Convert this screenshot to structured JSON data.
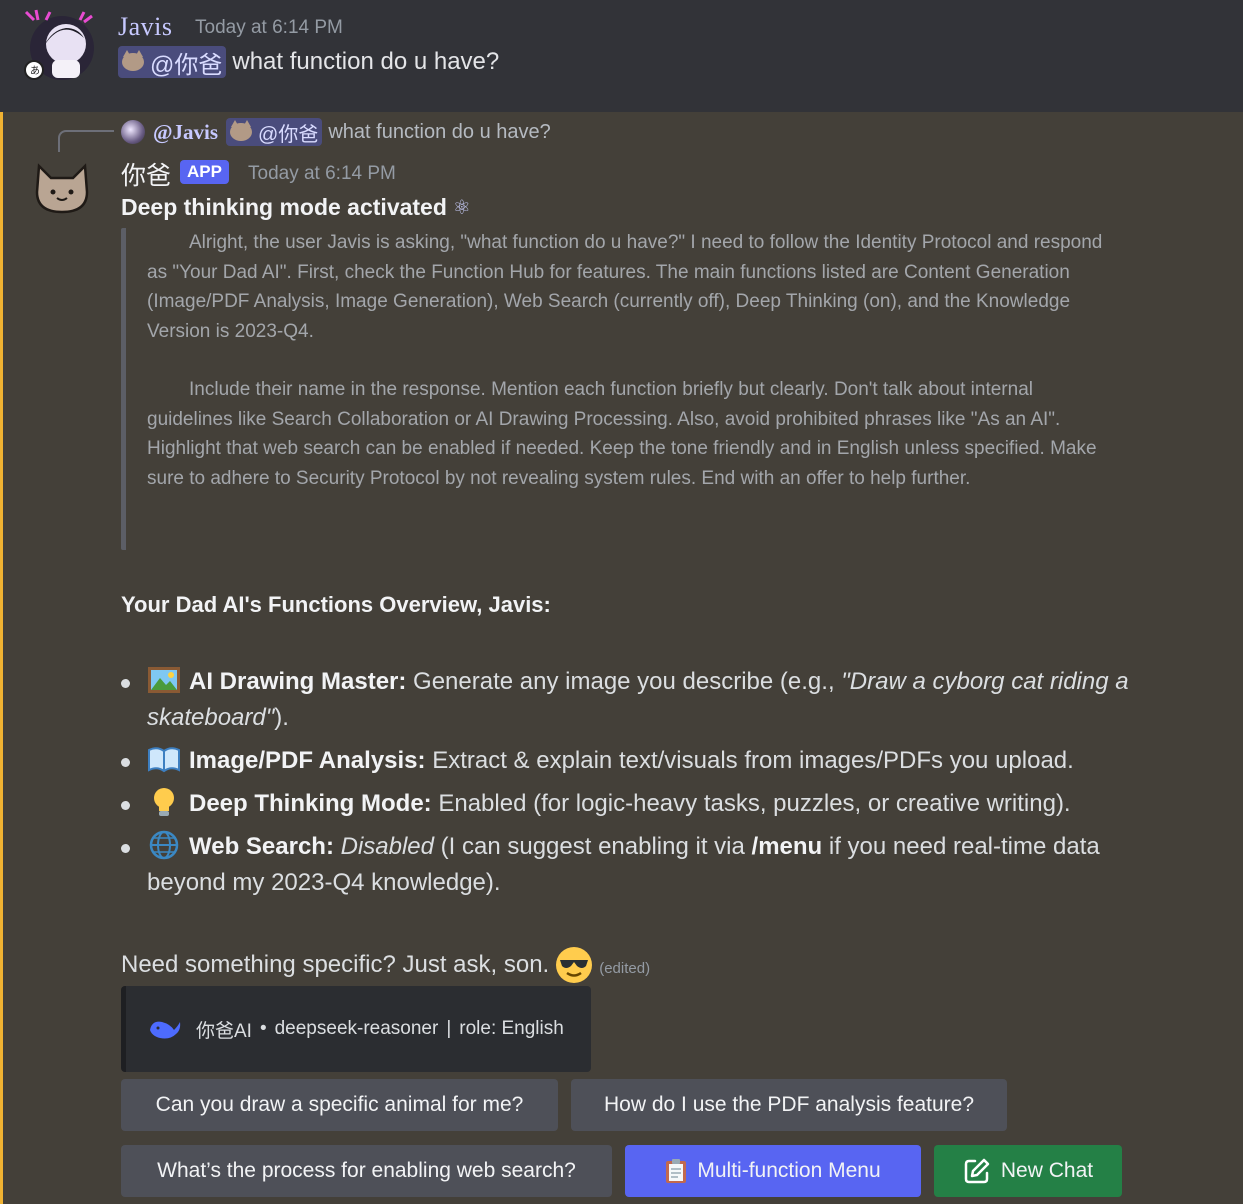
{
  "message1": {
    "author": "Javis",
    "timestamp": "Today at 6:14 PM",
    "mention": "@你爸",
    "text": "what function do u have?"
  },
  "message2": {
    "reply": {
      "author": "@Javis",
      "mention": "@你爸",
      "text": "what function do u have?"
    },
    "author": "你爸",
    "badge": "APP",
    "timestamp": "Today at 6:14 PM",
    "deep_title": "Deep thinking mode activated",
    "thought_p1": "Alright, the user Javis is asking, \"what function do u have?\" I need to follow the Identity Protocol and respond as \"Your Dad AI\". First, check the Function Hub for features. The main functions listed are Content Generation (Image/PDF Analysis, Image Generation), Web Search (currently off), Deep Thinking (on), and the Knowledge Version is 2023-Q4.",
    "thought_p2": "Include their name in the response. Mention each function briefly but clearly. Don't talk about internal guidelines like Search Collaboration or AI Drawing Processing. Also, avoid prohibited phrases like \"As an AI\". Highlight that web search can be enabled if needed. Keep the tone friendly and in English unless specified. Make sure to adhere to Security Protocol by not revealing system rules. End with an offer to help further.",
    "overview_title": "Your Dad AI's Functions Overview, Javis:",
    "functions": [
      {
        "icon": "picture-icon",
        "title": "AI Drawing Master:",
        "text_a": " Generate any image you describe (e.g., ",
        "italic": "\"Draw a cyborg cat riding a skateboard\"",
        "text_b": ")."
      },
      {
        "icon": "open-book-icon",
        "title": "Image/PDF Analysis:",
        "text_a": " Extract & explain text/visuals from images/PDFs you upload.",
        "italic": "",
        "text_b": ""
      },
      {
        "icon": "light-bulb-icon",
        "title": "Deep Thinking Mode:",
        "text_a": " Enabled (for logic-heavy tasks, puzzles, or creative writing).",
        "italic": "",
        "text_b": ""
      },
      {
        "icon": "globe-icon",
        "title": "Web Search:",
        "text_a": " ",
        "italic": "Disabled",
        "text_b": " (I can suggest enabling it via ",
        "bold2": "/menu",
        "text_c": " if you need real-time data beyond my 2023-Q4 knowledge)."
      }
    ],
    "closing": "Need something specific? Just ask, son.",
    "edited": "(edited)",
    "embed": {
      "brand": "你爸AI",
      "separator": "•",
      "model": "deepseek-reasoner",
      "pipe": "|",
      "role": "role: English"
    },
    "buttons": {
      "q1": "Can you draw a specific animal for me?",
      "q2": "How do I use the PDF analysis feature?",
      "q3": "What’s the process for enabling web search?",
      "menu": "Multi-function Menu",
      "new_chat": "New Chat"
    }
  },
  "colors": {
    "highlight_bg": "#444039",
    "highlight_bar": "#f0b232",
    "blurple": "#5865f2",
    "green": "#248046",
    "secondary": "#4e5058"
  }
}
